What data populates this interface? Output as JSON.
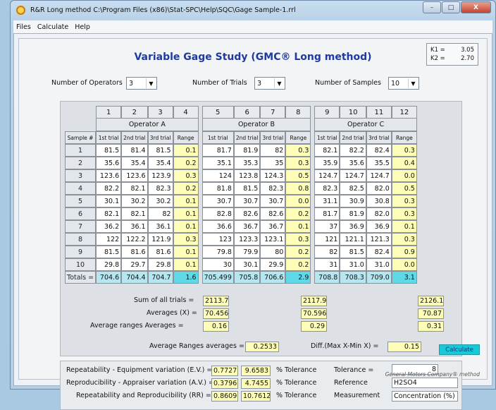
{
  "window": {
    "title": "R&R Long method   C:\\Program Files (x86)\\Stat-SPC\\Help\\SQC\\Gage Sample-1.rrl",
    "minimize": "–",
    "maximize": "□",
    "close": "X"
  },
  "menu": [
    "Files",
    "Calculate",
    "Help"
  ],
  "heading": "Variable Gage Study (GMC® Long method)",
  "k": {
    "k1_label": "K1 =",
    "k1": "3.05",
    "k2_label": "K2 =",
    "k2": "2.70"
  },
  "controls": {
    "operators_label": "Number of Operators",
    "operators": "3",
    "trials_label": "Number of Trials",
    "trials": "3",
    "samples_label": "Number of Samples",
    "samples": "10"
  },
  "grid": {
    "col_numbers": [
      "1",
      "2",
      "3",
      "4",
      "5",
      "6",
      "7",
      "8",
      "9",
      "10",
      "11",
      "12"
    ],
    "operators": [
      "Operator A",
      "Operator B",
      "Operator C"
    ],
    "sample_header": "Sample #",
    "sub_headers": [
      "1st trial",
      "2nd trial",
      "3rd trial",
      "Range"
    ],
    "rows": [
      {
        "n": "1",
        "c": [
          "81.5",
          "81.4",
          "81.5",
          "0.1",
          "81.7",
          "81.9",
          "82",
          "0.3",
          "82.1",
          "82.2",
          "82.4",
          "0.3"
        ]
      },
      {
        "n": "2",
        "c": [
          "35.6",
          "35.4",
          "35.4",
          "0.2",
          "35.1",
          "35.3",
          "35",
          "0.3",
          "35.9",
          "35.6",
          "35.5",
          "0.4"
        ]
      },
      {
        "n": "3",
        "c": [
          "123.6",
          "123.6",
          "123.9",
          "0.3",
          "124",
          "123.8",
          "124.3",
          "0.5",
          "124.7",
          "124.7",
          "124.7",
          "0.0"
        ]
      },
      {
        "n": "4",
        "c": [
          "82.2",
          "82.1",
          "82.3",
          "0.2",
          "81.8",
          "81.5",
          "82.3",
          "0.8",
          "82.3",
          "82.5",
          "82.0",
          "0.5"
        ]
      },
      {
        "n": "5",
        "c": [
          "30.1",
          "30.2",
          "30.2",
          "0.1",
          "30.7",
          "30.7",
          "30.7",
          "0.0",
          "31.1",
          "30.9",
          "30.8",
          "0.3"
        ]
      },
      {
        "n": "6",
        "c": [
          "82.1",
          "82.1",
          "82",
          "0.1",
          "82.8",
          "82.6",
          "82.6",
          "0.2",
          "81.7",
          "81.9",
          "82.0",
          "0.3"
        ]
      },
      {
        "n": "7",
        "c": [
          "36.2",
          "36.1",
          "36.1",
          "0.1",
          "36.6",
          "36.7",
          "36.7",
          "0.1",
          "37",
          "36.9",
          "36.9",
          "0.1"
        ]
      },
      {
        "n": "8",
        "c": [
          "122",
          "122.2",
          "121.9",
          "0.3",
          "123",
          "123.3",
          "123.1",
          "0.3",
          "121",
          "121.1",
          "121.3",
          "0.3"
        ]
      },
      {
        "n": "9",
        "c": [
          "81.5",
          "81.6",
          "81.6",
          "0.1",
          "79.8",
          "79.9",
          "80",
          "0.2",
          "82",
          "81.5",
          "82.4",
          "0.9"
        ]
      },
      {
        "n": "10",
        "c": [
          "29.8",
          "29.7",
          "29.8",
          "0.1",
          "30",
          "30.1",
          "29.9",
          "0.2",
          "31",
          "31.0",
          "31.0",
          "0.0"
        ]
      }
    ],
    "totals_label": "Totals =",
    "totals": [
      "704.6",
      "704.4",
      "704.7",
      "1.6",
      "705.499",
      "705.8",
      "706.6",
      "2.9",
      "708.8",
      "708.3",
      "709.0",
      "3.1"
    ]
  },
  "summary": {
    "sum_label": "Sum of all trials =",
    "averages_label": "Averages (X) =",
    "avg_ranges_label": "Average ranges Averages =",
    "a": {
      "sum": "2113.7",
      "avg": "70.4567",
      "range": "0.16"
    },
    "b": {
      "sum": "2117.9",
      "avg": "70.5967",
      "range": "0.29"
    },
    "c": {
      "sum": "2126.1",
      "avg": "70.87",
      "range": "0.31"
    },
    "avg_ranges_averages_label": "Average Ranges averages =",
    "avg_ranges_averages": "0.2533",
    "diff_label": "Diff.(Max X-Min X) =",
    "diff": "0.15",
    "calculate": "Calculate"
  },
  "results": {
    "ev_label": "Repeatability - Equipment variation (E.V.) =",
    "ev": "0.7727",
    "ev_pct": "9.6583",
    "av_label": "Reproducibility - Appraiser variation (A.V.) =",
    "av": "0.3796",
    "av_pct": "4.7455",
    "rr_label": "Repeatability and Reproducibility (RR) =",
    "rr": "0.8609",
    "rr_pct": "10.7612",
    "pct_tol": "% Tolerance",
    "tolerance_label": "Tolerance =",
    "tolerance": "8",
    "reference_label": "Reference",
    "reference": "H2SO4",
    "measurement_label": "Measurement",
    "measurement": "Concentration (%)",
    "footer": "General Motors Company® method"
  },
  "colors": {
    "title": "#1f3aa0",
    "range": "#fdfdb8",
    "totals": "#b6e7f0",
    "calculate": "#19c9d9"
  }
}
